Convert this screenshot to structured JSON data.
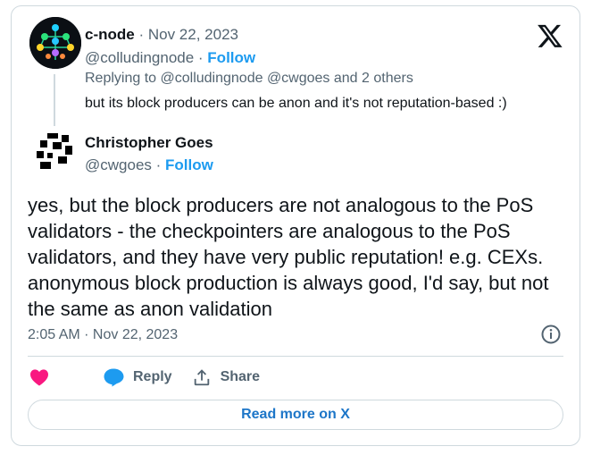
{
  "reply_to_tweet": {
    "author_name": "c-node",
    "separator": " · ",
    "date": "Nov 22, 2023",
    "handle": "@colludingnode",
    "follow_label": "Follow",
    "replying_to_prefix": "Replying to ",
    "replying_to": "@colludingnode @cwgoes and 2 others",
    "text": "but its block producers can be anon and it's not reputation-based :)"
  },
  "tweet": {
    "author_name": "Christopher Goes",
    "handle": "@cwgoes",
    "follow_label": "Follow",
    "text": "yes, but the block producers are not analogous to the PoS validators - the checkpointers are analogous to the PoS validators, and they have very public reputation! e.g. CEXs. anonymous block production is always good, I'd say, but not the same as anon validation",
    "timestamp": "2:05 AM · Nov 22, 2023"
  },
  "actions": {
    "reply_label": "Reply",
    "share_label": "Share"
  },
  "read_more_label": "Read more on X",
  "colors": {
    "accent": "#1d9bf0",
    "heart": "#f91880",
    "border": "#cfd9de",
    "muted": "#536471"
  },
  "icons": [
    "x-logo-icon",
    "heart-icon",
    "reply-icon",
    "share-icon",
    "info-icon"
  ]
}
